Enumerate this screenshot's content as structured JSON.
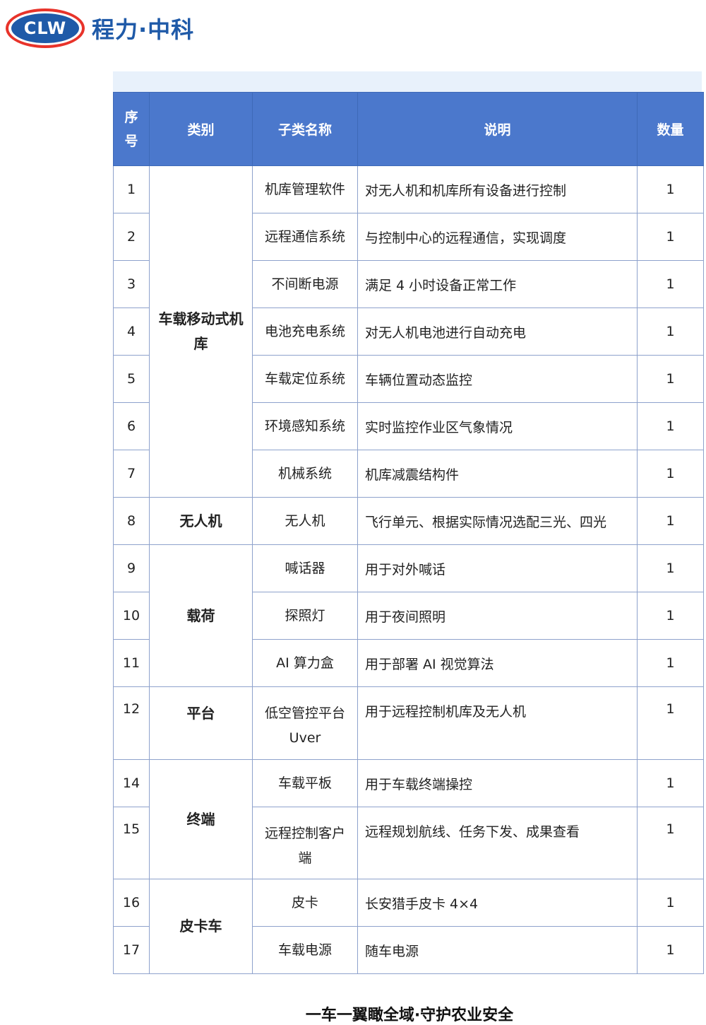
{
  "logo": {
    "letters": "CLW",
    "name": "程力·中科"
  },
  "table": {
    "headers": {
      "seq": "序号",
      "category": "类别",
      "subname": "子类名称",
      "desc": "说明",
      "qty": "数量"
    },
    "categories": {
      "hangar": "车载移动式机库",
      "drone": "无人机",
      "payload": "载荷",
      "platform": "平台",
      "terminal": "终端",
      "pickup": "皮卡车"
    },
    "rows": [
      {
        "no": "1",
        "name": "机库管理软件",
        "desc": "对无人机和机库所有设备进行控制",
        "qty": "1"
      },
      {
        "no": "2",
        "name": "远程通信系统",
        "desc": "与控制中心的远程通信，实现调度",
        "qty": "1"
      },
      {
        "no": "3",
        "name": "不间断电源",
        "desc": "满足 4 小时设备正常工作",
        "qty": "1"
      },
      {
        "no": "4",
        "name": "电池充电系统",
        "desc": "对无人机电池进行自动充电",
        "qty": "1"
      },
      {
        "no": "5",
        "name": "车载定位系统",
        "desc": "车辆位置动态监控",
        "qty": "1"
      },
      {
        "no": "6",
        "name": "环境感知系统",
        "desc": "实时监控作业区气象情况",
        "qty": "1"
      },
      {
        "no": "7",
        "name": "机械系统",
        "desc": "机库减震结构件",
        "qty": "1"
      },
      {
        "no": "8",
        "name": "无人机",
        "desc": "飞行单元、根据实际情况选配三光、四光",
        "qty": "1"
      },
      {
        "no": "9",
        "name": "喊话器",
        "desc": "用于对外喊话",
        "qty": "1"
      },
      {
        "no": "10",
        "name": "探照灯",
        "desc": "用于夜间照明",
        "qty": "1"
      },
      {
        "no": "11",
        "name": "AI 算力盒",
        "desc": "用于部署 AI 视觉算法",
        "qty": "1"
      },
      {
        "no": "12",
        "name": "低空管控平台 Uver",
        "desc": "用于远程控制机库及无人机",
        "qty": "1"
      },
      {
        "no": "14",
        "name": "车载平板",
        "desc": "用于车载终端操控",
        "qty": "1"
      },
      {
        "no": "15",
        "name": "远程控制客户端",
        "desc": "远程规划航线、任务下发、成果查看",
        "qty": "1"
      },
      {
        "no": "16",
        "name": "皮卡",
        "desc": "长安猎手皮卡 4×4",
        "qty": "1"
      },
      {
        "no": "17",
        "name": "车载电源",
        "desc": "随车电源",
        "qty": "1"
      }
    ]
  },
  "footer": {
    "slogan": "一车一翼瞰全域·守护农业安全"
  },
  "colors": {
    "header_bg": "#4b78cc",
    "brand_blue": "#1f5aa8",
    "brand_red": "#e8332a"
  }
}
